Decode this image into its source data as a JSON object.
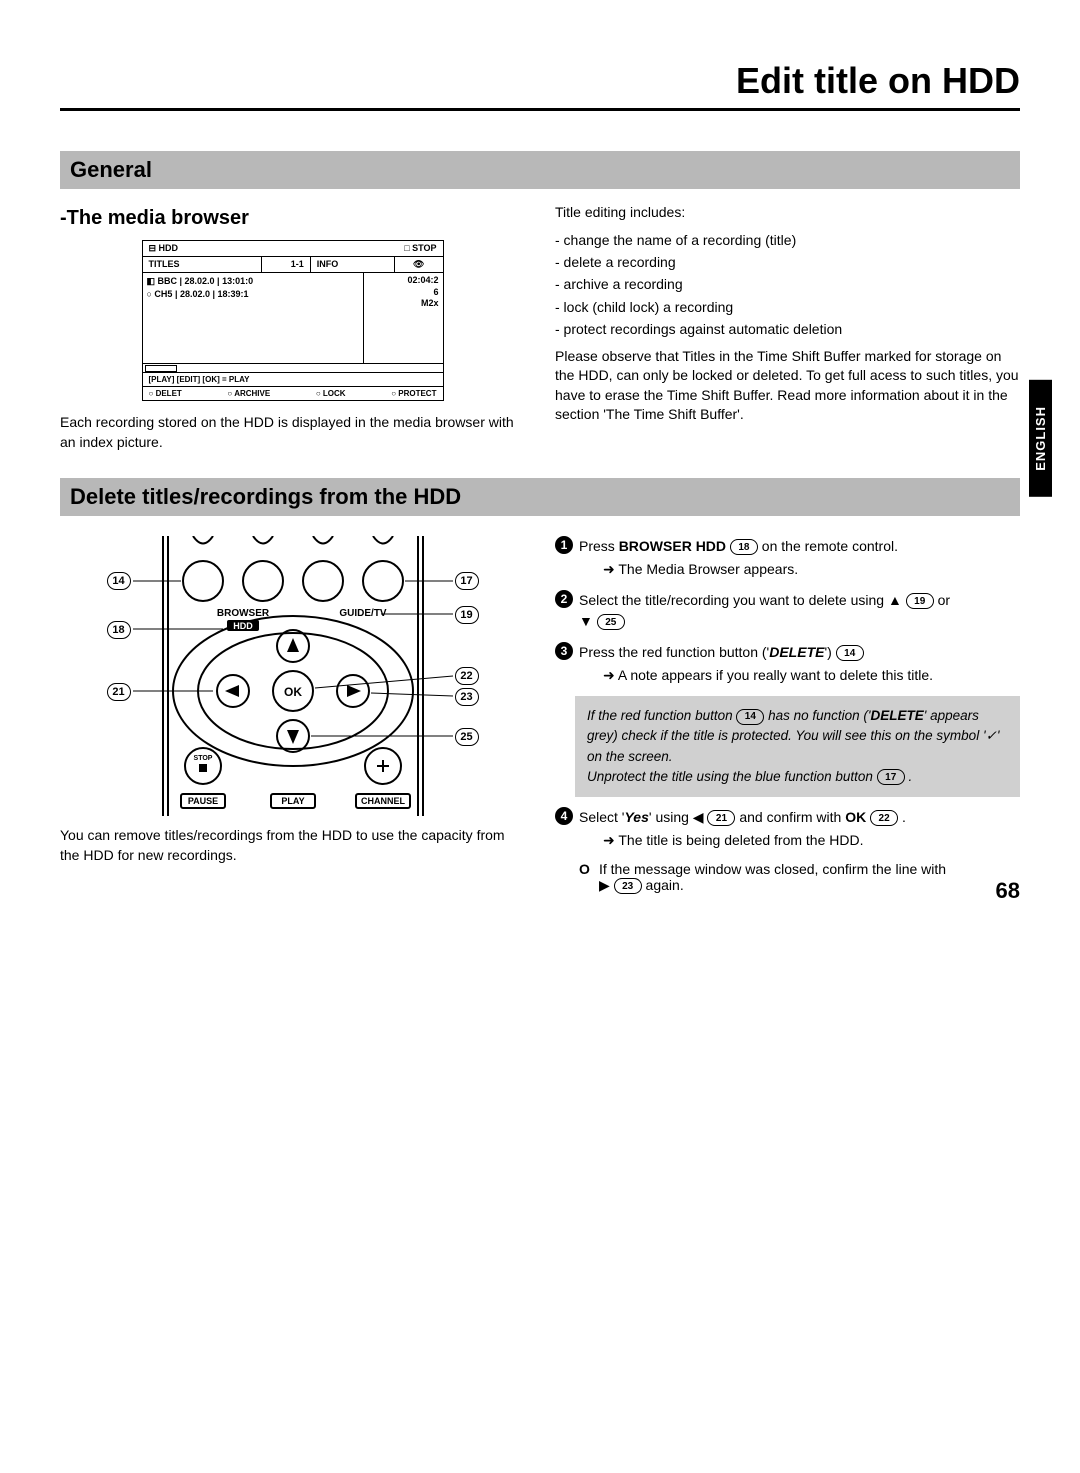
{
  "page_title": "Edit title on HDD",
  "language_tab": "ENGLISH",
  "page_number": "68",
  "sections": {
    "general": {
      "heading": "General",
      "media_browser": {
        "title": "-The media browser",
        "caption": "Each recording stored on the HDD is displayed in the media browser with an index picture.",
        "osd": {
          "top_left": "HDD",
          "top_right": "STOP",
          "col_titles": "TITLES",
          "col_index": "1-1",
          "col_info": "INFO",
          "eye_icon": "👁",
          "row1": "BBC | 28.02.0 | 13:01:0",
          "row2": "○ CH5 | 28.02.0 | 18:39:1",
          "info1": "02:04:2",
          "info2": "6",
          "info3": "M2x",
          "hint": "[PLAY] [EDIT] [OK] = PLAY",
          "btn1": "DELET",
          "btn2": "ARCHIVE",
          "btn3": "LOCK",
          "btn4": "PROTECT"
        }
      },
      "right_col": {
        "intro": "Title editing includes:",
        "bullets": [
          "- change the name of a recording (title)",
          "- delete a recording",
          "- archive a recording",
          "- lock (child lock) a recording",
          "- protect recordings against automatic deletion"
        ],
        "para": "Please observe that Titles in the Time Shift Buffer marked for storage on the HDD, can only be locked or deleted. To get full acess to such titles, you have to erase the Time Shift Buffer. Read more information about it in the section 'The Time Shift Buffer'."
      }
    },
    "delete": {
      "heading": "Delete titles/recordings from the HDD",
      "left_caption": "You can remove titles/recordings from the HDD to use the capacity from the HDD for new recordings.",
      "remote": {
        "browser": "BROWSER",
        "hdd": "HDD",
        "guide": "GUIDE/TV",
        "ok": "OK",
        "stop": "STOP",
        "pause": "PAUSE",
        "play": "PLAY",
        "channel": "CHANNEL",
        "callouts": {
          "c14": "14",
          "c17": "17",
          "c18": "18",
          "c19": "19",
          "c21": "21",
          "c22": "22",
          "c23": "23",
          "c25": "25"
        }
      },
      "steps": {
        "s1_a": "Press ",
        "s1_b": "BROWSER HDD",
        "s1_c": " on the remote control.",
        "s1_sub": "The Media Browser appears.",
        "s2_a": "Select the title/recording you want to delete using ",
        "s2_b": " or ",
        "s3_a": "Press the red function button ('",
        "s3_b": "DELETE",
        "s3_c": "') ",
        "s3_sub": "A note appears if you really want to delete this title.",
        "note_l1a": "If the red function button ",
        "note_l1b": " has no function ('",
        "note_l1c": "DELETE",
        "note_l1d": "' appears grey) check if the title is protected. You will see this on the symbol '✓' on the screen.",
        "note_l2a": "Unprotect the title using the blue function button ",
        "note_l2b": " .",
        "s4_a": "Select '",
        "s4_b": "Yes",
        "s4_c": "' using ",
        "s4_d": " and confirm with ",
        "s4_e": "OK",
        "s4_f": " .",
        "s4_sub": "The title is being deleted from the HDD.",
        "o_a": "If the message window was closed, confirm the line with ",
        "o_b": " again."
      }
    }
  }
}
